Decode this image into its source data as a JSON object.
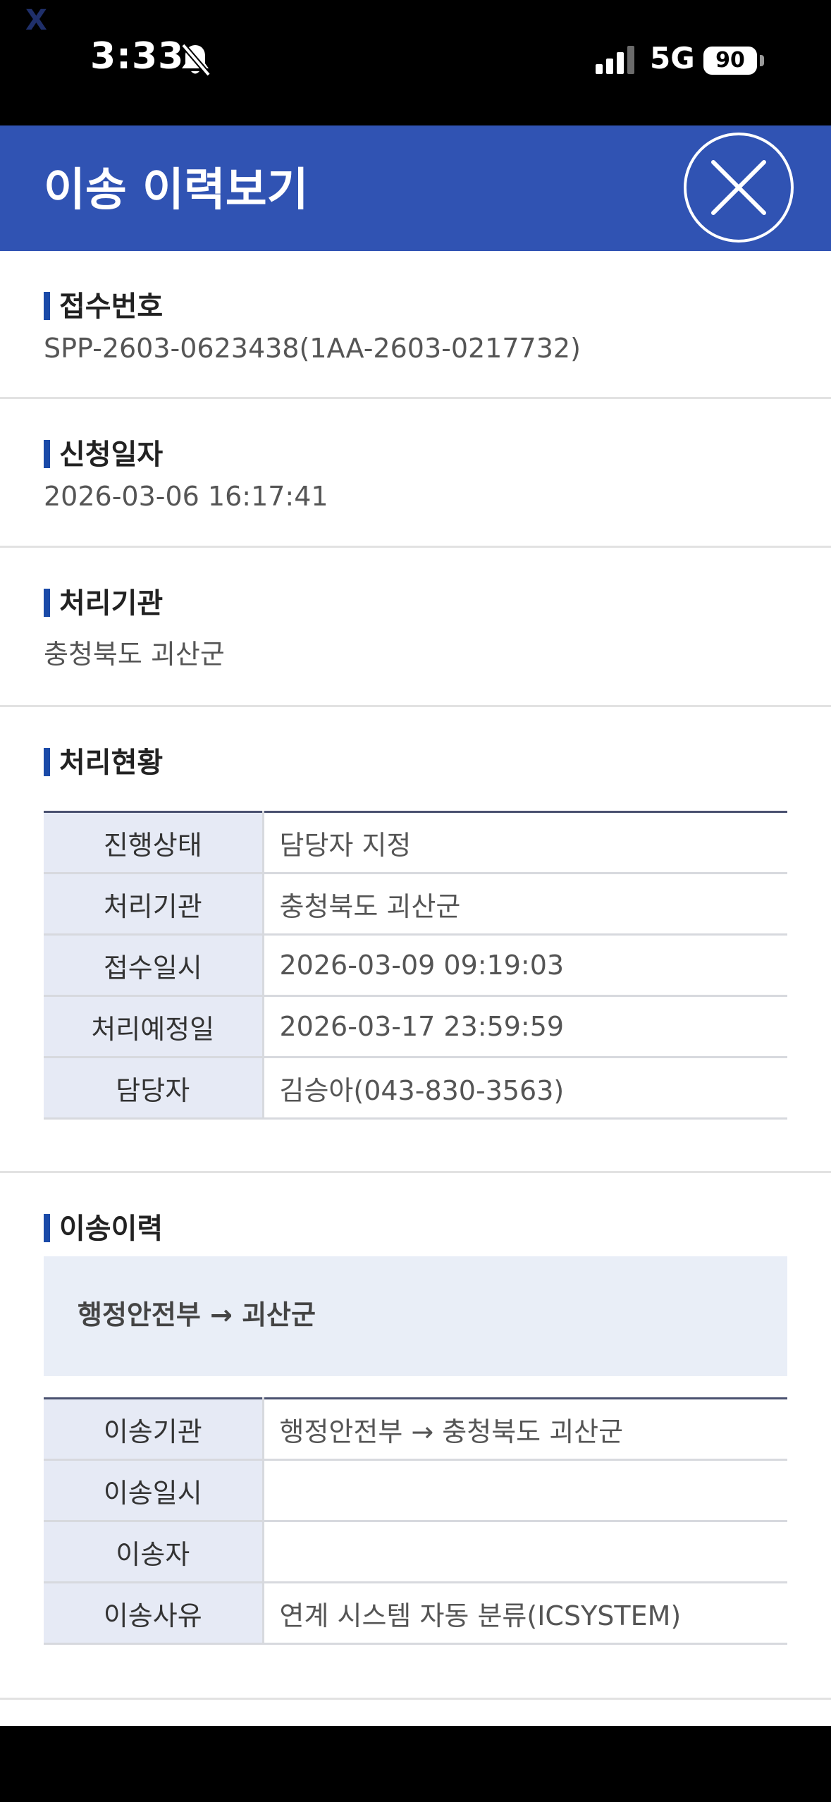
{
  "status_bar": {
    "corner_mark": "X",
    "time": "3:33",
    "network": "5G",
    "battery": "90"
  },
  "header": {
    "title": "이송 이력보기"
  },
  "reception": {
    "title": "접수번호",
    "value": "SPP-2603-0623438(1AA-2603-0217732)"
  },
  "application_date": {
    "title": "신청일자",
    "value": "2026-03-06 16:17:41"
  },
  "processing_agency": {
    "title": "처리기관",
    "value": "충청북도 괴산군"
  },
  "processing_status": {
    "title": "처리현황",
    "rows": [
      {
        "label": "진행상태",
        "value": "담당자 지정"
      },
      {
        "label": "처리기관",
        "value": "충청북도 괴산군"
      },
      {
        "label": "접수일시",
        "value": "2026-03-09 09:19:03"
      },
      {
        "label": "처리예정일",
        "value": "2026-03-17 23:59:59"
      },
      {
        "label": "담당자",
        "value": "김승아(043-830-3563)"
      }
    ]
  },
  "transfer_history": {
    "title": "이송이력",
    "route": "행정안전부 → 괴산군",
    "rows": [
      {
        "label": "이송기관",
        "value": "행정안전부 → 충청북도 괴산군"
      },
      {
        "label": "이송일시",
        "value": ""
      },
      {
        "label": "이송자",
        "value": ""
      },
      {
        "label": "이송사유",
        "value": "연계 시스템 자동 분류(ICSYSTEM)"
      }
    ]
  }
}
